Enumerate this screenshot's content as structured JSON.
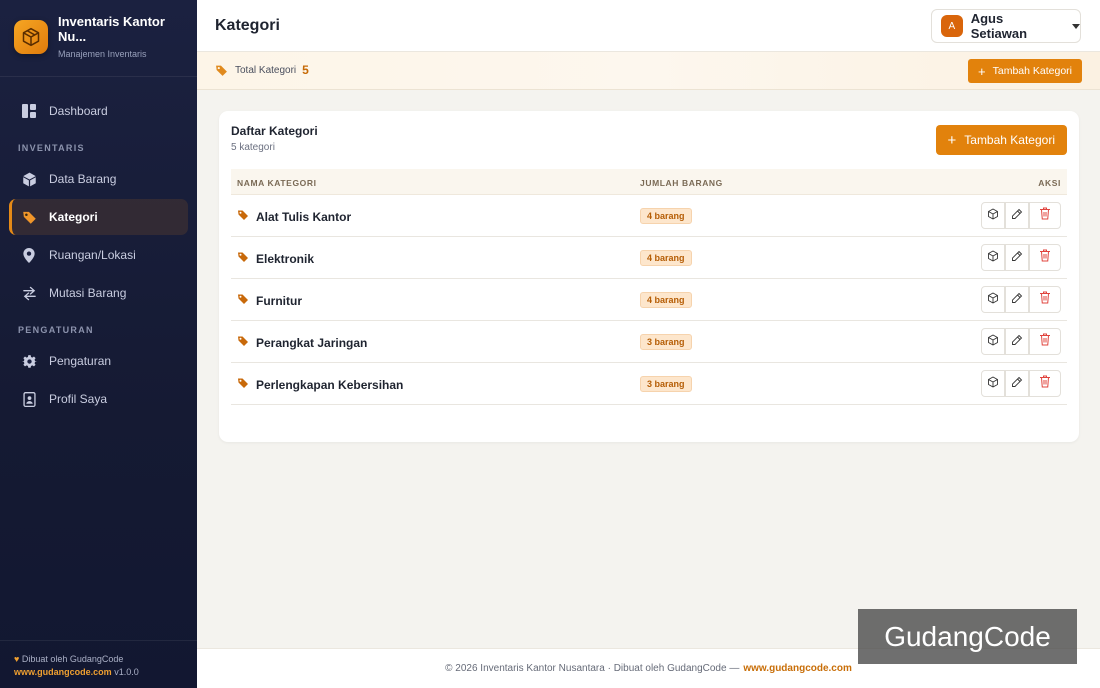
{
  "app": {
    "title": "Inventaris Kantor Nu...",
    "subtitle": "Manajemen Inventaris"
  },
  "sidebar": {
    "dashboard": "Dashboard",
    "section_inventaris": "INVENTARIS",
    "data_barang": "Data Barang",
    "kategori": "Kategori",
    "ruangan": "Ruangan/Lokasi",
    "mutasi": "Mutasi Barang",
    "section_pengaturan": "PENGATURAN",
    "pengaturan": "Pengaturan",
    "profil": "Profil Saya",
    "footer_made_by": "Dibuat oleh GudangCode",
    "footer_link": "www.gudangcode.com",
    "footer_version": "v1.0.0"
  },
  "header": {
    "page_title": "Kategori",
    "user_initial": "A",
    "user_name": "Agus Setiawan"
  },
  "statbar": {
    "label": "Total Kategori",
    "count": "5",
    "add_button": "Tambah Kategori"
  },
  "card": {
    "title": "Daftar Kategori",
    "subtitle": "5 kategori",
    "add_button": "Tambah Kategori",
    "col_name": "NAMA KATEGORI",
    "col_count": "JUMLAH BARANG",
    "col_actions": "AKSI"
  },
  "rows": [
    {
      "name": "Alat Tulis Kantor",
      "count": "4 barang"
    },
    {
      "name": "Elektronik",
      "count": "4 barang"
    },
    {
      "name": "Furnitur",
      "count": "4 barang"
    },
    {
      "name": "Perangkat Jaringan",
      "count": "3 barang"
    },
    {
      "name": "Perlengkapan Kebersihan",
      "count": "3 barang"
    }
  ],
  "footer": {
    "text": "© 2026 Inventaris Kantor Nusantara · Dibuat oleh GudangCode —",
    "link": "www.gudangcode.com"
  },
  "watermark": "GudangCode",
  "colors": {
    "accent": "#e2820c",
    "sidebar_bg": "#1b2140",
    "danger": "#e0443e"
  }
}
